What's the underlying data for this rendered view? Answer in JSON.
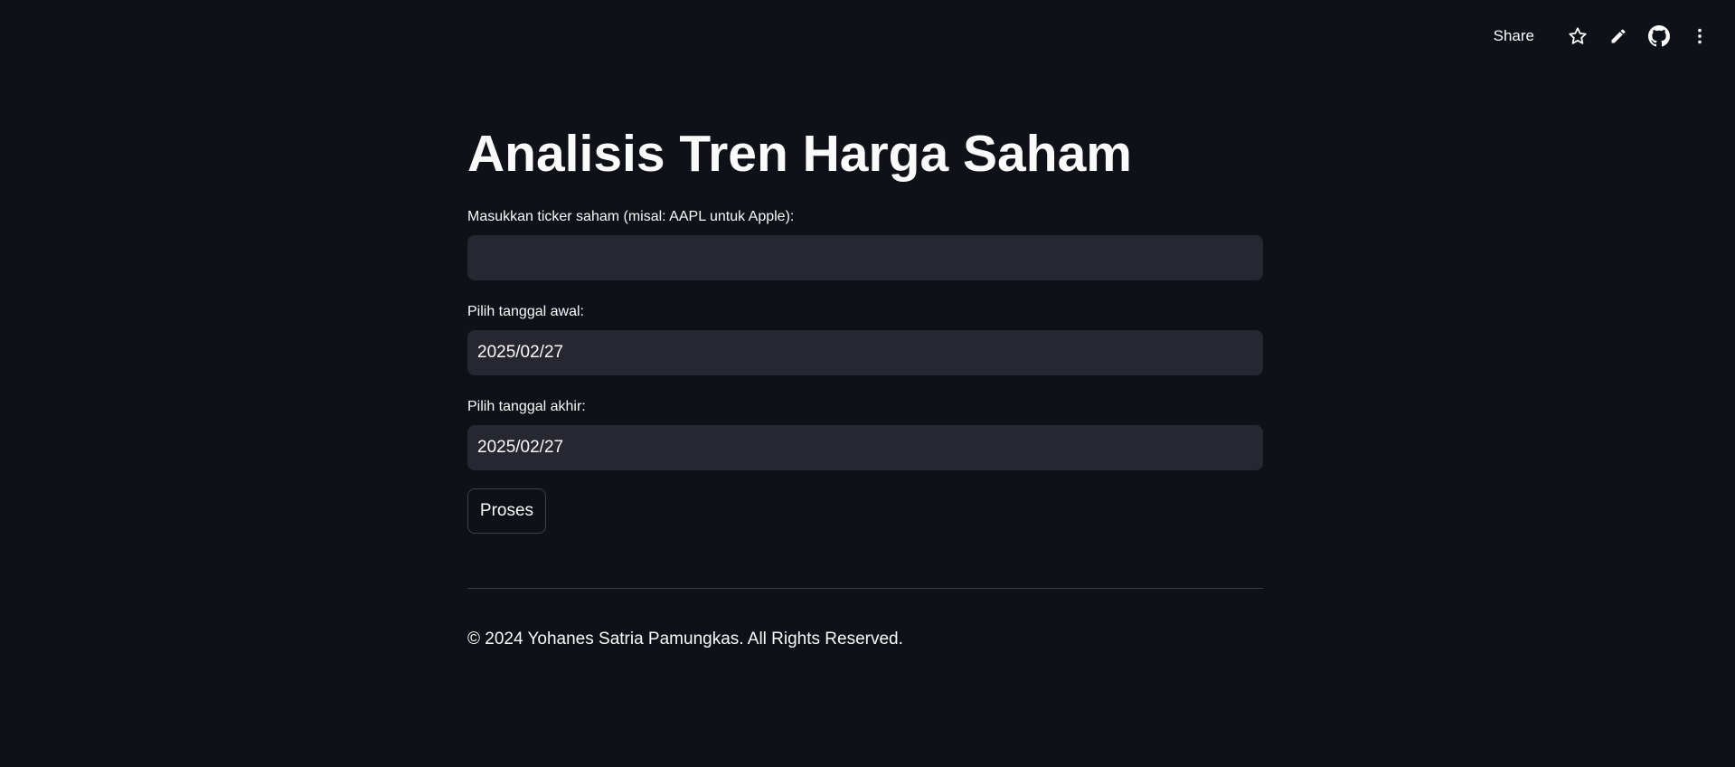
{
  "toolbar": {
    "share_label": "Share",
    "icons": [
      "star-icon",
      "pencil-icon",
      "github-icon",
      "more-vertical-icon"
    ]
  },
  "main": {
    "title": "Analisis Tren Harga Saham",
    "ticker": {
      "label": "Masukkan ticker saham (misal: AAPL untuk Apple):",
      "value": ""
    },
    "start_date": {
      "label": "Pilih tanggal awal:",
      "value": "2025/02/27"
    },
    "end_date": {
      "label": "Pilih tanggal akhir:",
      "value": "2025/02/27"
    },
    "submit_label": "Proses",
    "footer": "© 2024 Yohanes Satria Pamungkas. All Rights Reserved."
  },
  "colors": {
    "background": "#0e1117",
    "input_background": "#262730",
    "text": "#fafafa",
    "divider": "#3a3d45"
  }
}
